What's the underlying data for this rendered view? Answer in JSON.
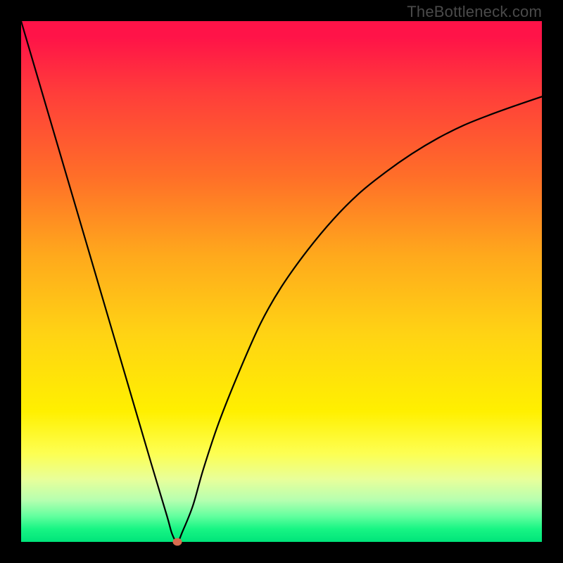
{
  "watermark": "TheBottleneck.com",
  "chart_data": {
    "type": "line",
    "title": "",
    "xlabel": "",
    "ylabel": "",
    "xlim": [
      0,
      100
    ],
    "ylim": [
      0,
      100
    ],
    "background": "red-yellow-green vertical gradient (red top, green bottom)",
    "series": [
      {
        "name": "bottleneck-curve",
        "x": [
          0,
          5,
          10,
          15,
          20,
          25,
          28,
          29,
          30,
          31,
          33,
          35,
          38,
          42,
          46,
          50,
          55,
          60,
          65,
          70,
          75,
          80,
          85,
          90,
          95,
          100
        ],
        "y": [
          100,
          83,
          66,
          49,
          32,
          15,
          5,
          1.5,
          0,
          2,
          7,
          14,
          23,
          33,
          42,
          49,
          56,
          62,
          67,
          71,
          74.5,
          77.5,
          80,
          82,
          83.8,
          85.5
        ]
      }
    ],
    "marker": {
      "x": 30,
      "y": 0,
      "radius_px": 6,
      "color": "#d96b4f"
    },
    "annotations": []
  }
}
